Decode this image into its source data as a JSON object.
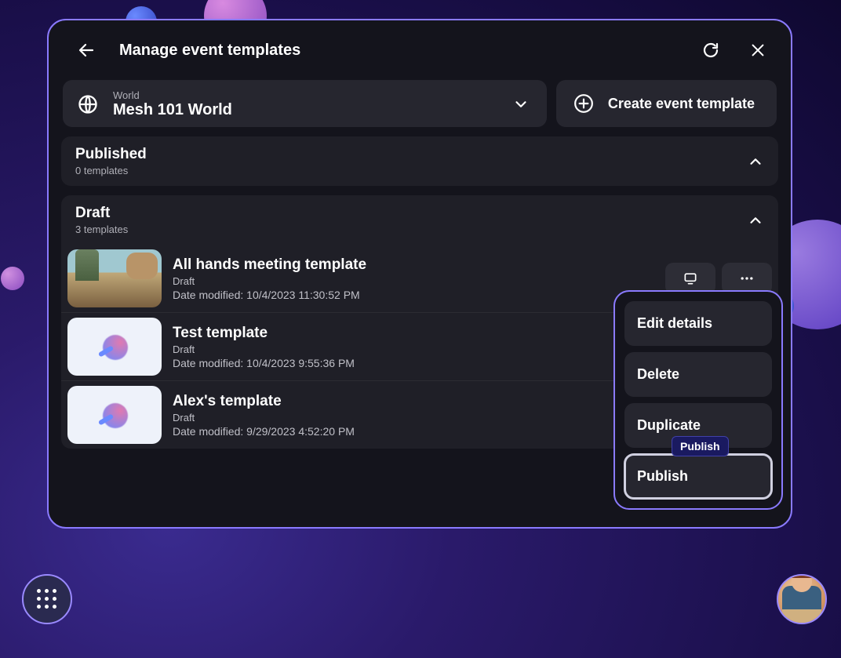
{
  "header": {
    "title": "Manage event templates"
  },
  "world_picker": {
    "label": "World",
    "value": "Mesh 101 World"
  },
  "create_button_label": "Create event template",
  "sections": {
    "published": {
      "name": "Published",
      "count": "0 templates"
    },
    "draft": {
      "name": "Draft",
      "count": "3 templates"
    }
  },
  "date_modified_label": "Date modified:",
  "templates": [
    {
      "name": "All hands meeting template",
      "status": "Draft",
      "date": "10/4/2023 11:30:52 PM"
    },
    {
      "name": "Test template",
      "status": "Draft",
      "date": "10/4/2023 9:55:36 PM"
    },
    {
      "name": "Alex's template",
      "status": "Draft",
      "date": "9/29/2023 4:52:20 PM"
    }
  ],
  "context_menu": {
    "edit": "Edit details",
    "delete": "Delete",
    "duplicate": "Duplicate",
    "publish": "Publish"
  },
  "tooltip": "Publish"
}
